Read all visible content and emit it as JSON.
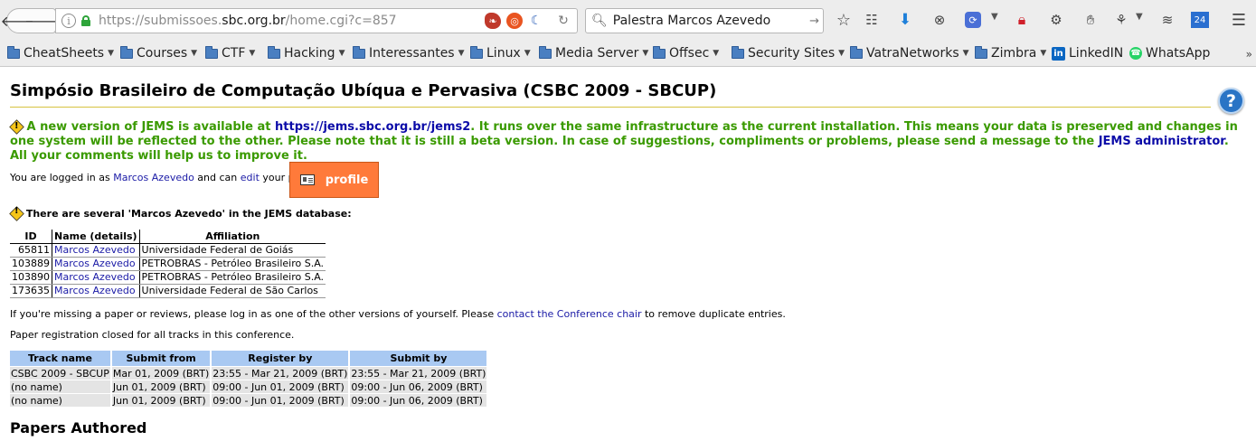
{
  "browser": {
    "url": {
      "scheme_sub": "https://submissoes.",
      "host": "sbc.org.br",
      "path": "/home.cgi?c=857"
    },
    "search_value": "Palestra Marcos Azevedo",
    "extension_badge": "24",
    "bookmarks": [
      {
        "label": "CheatSheets",
        "type": "folder"
      },
      {
        "label": "Courses",
        "type": "folder"
      },
      {
        "label": "CTF",
        "type": "folder"
      },
      {
        "label": "Hacking",
        "type": "folder"
      },
      {
        "label": "Interessantes",
        "type": "folder"
      },
      {
        "label": "Linux",
        "type": "folder"
      },
      {
        "label": "Media Server",
        "type": "folder"
      },
      {
        "label": "Offsec",
        "type": "folder"
      },
      {
        "label": "Security Sites",
        "type": "folder"
      },
      {
        "label": "VatraNetworks",
        "type": "folder"
      },
      {
        "label": "Zimbra",
        "type": "folder"
      },
      {
        "label": "LinkedIN",
        "type": "link"
      },
      {
        "label": "WhatsApp",
        "type": "link"
      }
    ]
  },
  "page": {
    "title": "Simpósio Brasileiro de Computação Ubíqua e Pervasiva (CSBC 2009 - SBCUP)",
    "notice": {
      "before_link": " A new version of JEMS is available at ",
      "link": "https://jems.sbc.org.br/jems2",
      "middle": ". It runs over the same infrastructure as the current installation. This means your data is preserved and changes in one system will be reflected to the other. Please note that it is still a beta version. In case of suggestions, compliments or problems, please send a message to the ",
      "admin_link": "JEMS administrator",
      "after": ". All your comments will help us to improve it."
    },
    "login": {
      "prefix": "You are logged in as ",
      "user": "Marcos Azevedo",
      "middle": " and can ",
      "edit_link": "edit",
      "suffix": " your profile.",
      "profile_button": "profile"
    },
    "several_notice": "There are several 'Marcos Azevedo' in the JEMS database:",
    "duplicates": {
      "headers": [
        "ID",
        "Name (details)",
        "Affiliation"
      ],
      "rows": [
        {
          "id": "65811",
          "name": "Marcos Azevedo",
          "affiliation": "Universidade Federal de Goiás"
        },
        {
          "id": "103889",
          "name": "Marcos Azevedo",
          "affiliation": "PETROBRAS - Petróleo Brasileiro S.A."
        },
        {
          "id": "103890",
          "name": "Marcos Azevedo",
          "affiliation": "PETROBRAS - Petróleo Brasileiro S.A."
        },
        {
          "id": "173635",
          "name": "Marcos Azevedo",
          "affiliation": "Universidade Federal de São Carlos"
        }
      ]
    },
    "missing": {
      "prefix": "If you're missing a paper or reviews, please log in as one of the other versions of yourself. Please ",
      "link": "contact the Conference chair",
      "suffix": " to remove duplicate entries."
    },
    "closed_text": "Paper registration closed for all tracks in this conference.",
    "tracks": {
      "headers": [
        "Track name",
        "Submit from",
        "Register by",
        "Submit by"
      ],
      "rows": [
        [
          "CSBC 2009 - SBCUP",
          "Mar 01, 2009 (BRT)",
          "23:55 - Mar 21, 2009 (BRT)",
          "23:55 - Mar 21, 2009 (BRT)"
        ],
        [
          "(no name)",
          "Jun 01, 2009 (BRT)",
          "09:00 - Jun 01, 2009 (BRT)",
          "09:00 - Jun 06, 2009 (BRT)"
        ],
        [
          "(no name)",
          "Jun 01, 2009 (BRT)",
          "09:00 - Jun 01, 2009 (BRT)",
          "09:00 - Jun 06, 2009 (BRT)"
        ]
      ]
    },
    "papers_title": "Papers Authored"
  },
  "colors": {
    "notice_green": "#3a9a00",
    "link_blue": "#1a1aa6",
    "profile_orange": "#ff7a3a",
    "track_header_blue": "#a9c9f2",
    "title_rule": "#d6c240"
  }
}
